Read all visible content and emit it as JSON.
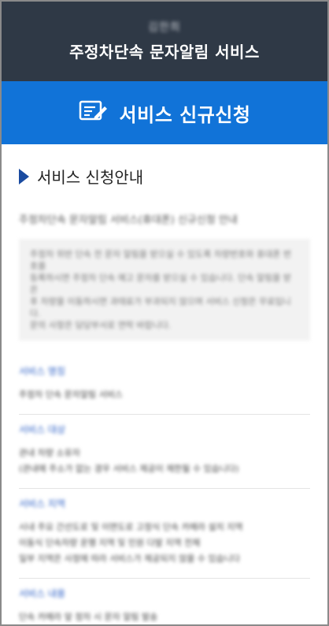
{
  "header": {
    "org_name": "김한희",
    "service_title": "주정차단속 문자알림 서비스"
  },
  "banner": {
    "icon": "form-pen-icon",
    "title": "서비스 신규신청"
  },
  "section": {
    "heading": "서비스 신청안내",
    "intro": "주정차단속 문자알림 서비스(휴대폰) 신규신청 안내",
    "notice": [
      "주정차 위반 단속 전 문자 알림을 받으실 수 있도록 차량번호와 휴대폰 번호를",
      "등록하시면 주정차 단속 예고 문자를 받으실 수 있습니다. 단속 알림을 받은",
      "후 차량을 이동하시면 과태료가 부과되지 않으며 서비스 신청은 무료입니다.",
      "문의 사항은 담당부서로 연락 바랍니다."
    ]
  },
  "items": [
    {
      "label": "서비스 명칭",
      "lines": [
        "주정차 단속 문자알림 서비스"
      ]
    },
    {
      "label": "서비스 대상",
      "lines": [
        "관내 차량 소유자",
        "(관내에 주소가 없는 경우 서비스 제공이 제한될 수 있습니다)"
      ]
    },
    {
      "label": "서비스 지역",
      "lines": [
        "시내 주요 간선도로 및 이면도로 고정식 단속 카메라 설치 지역",
        "이동식 단속차량 운행 지역 및 민원 다발 지역 전체",
        "일부 지역은 사정에 따라 서비스가 제공되지 않을 수 있습니다"
      ]
    },
    {
      "label": "서비스 내용",
      "lines": [
        "단속 카메라 앞 정차 시 문자 알림 발송"
      ]
    }
  ]
}
